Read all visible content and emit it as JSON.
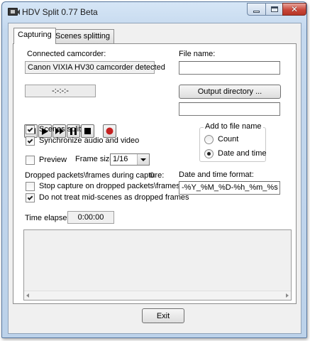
{
  "window": {
    "title": "HDV Split 0.77 Beta"
  },
  "tabs": [
    {
      "label": "Capturing",
      "active": true
    },
    {
      "label": "Scenes splitting",
      "active": false
    }
  ],
  "capture": {
    "connected_label": "Connected camcorder:",
    "camcorder_status": "Canon VIXIA HV30 camcorder detected",
    "timecode": "-:-:-:-",
    "media_buttons": [
      "rewind-icon",
      "play-icon",
      "fast-forward-icon",
      "pause-icon",
      "stop-icon",
      "record-icon"
    ],
    "scenes_split": {
      "label": "Scenes split",
      "checked": true
    },
    "sync_av": {
      "label": "Synchronize audio and video",
      "checked": true
    },
    "preview": {
      "label": "Preview",
      "checked": false
    },
    "frame_size": {
      "label": "Frame size:",
      "value": "1/16"
    },
    "dropped_label": "Dropped packets\\frames during capture:",
    "dropped_count": "0",
    "stop_on_dropped": {
      "label": "Stop capture on dropped packets\\frames",
      "checked": false
    },
    "no_midscene_dropped": {
      "label": "Do not treat mid-scenes as dropped frames",
      "checked": true
    },
    "time_elapsed_label": "Time elapsed:",
    "time_elapsed": "0:00:00"
  },
  "file": {
    "name_label": "File name:",
    "name_value": "",
    "output_dir_button": "Output directory ...",
    "output_dir_value": "",
    "add_group_label": "Add to file name",
    "options": [
      {
        "label": "Count",
        "selected": false
      },
      {
        "label": "Date and time",
        "selected": true
      }
    ],
    "format_label": "Date and time format:",
    "format_value": "-%Y_%M_%D-%h_%m_%s"
  },
  "footer": {
    "exit_label": "Exit"
  },
  "colors": {
    "record": "#c42121",
    "close_button": "#c9473a"
  }
}
